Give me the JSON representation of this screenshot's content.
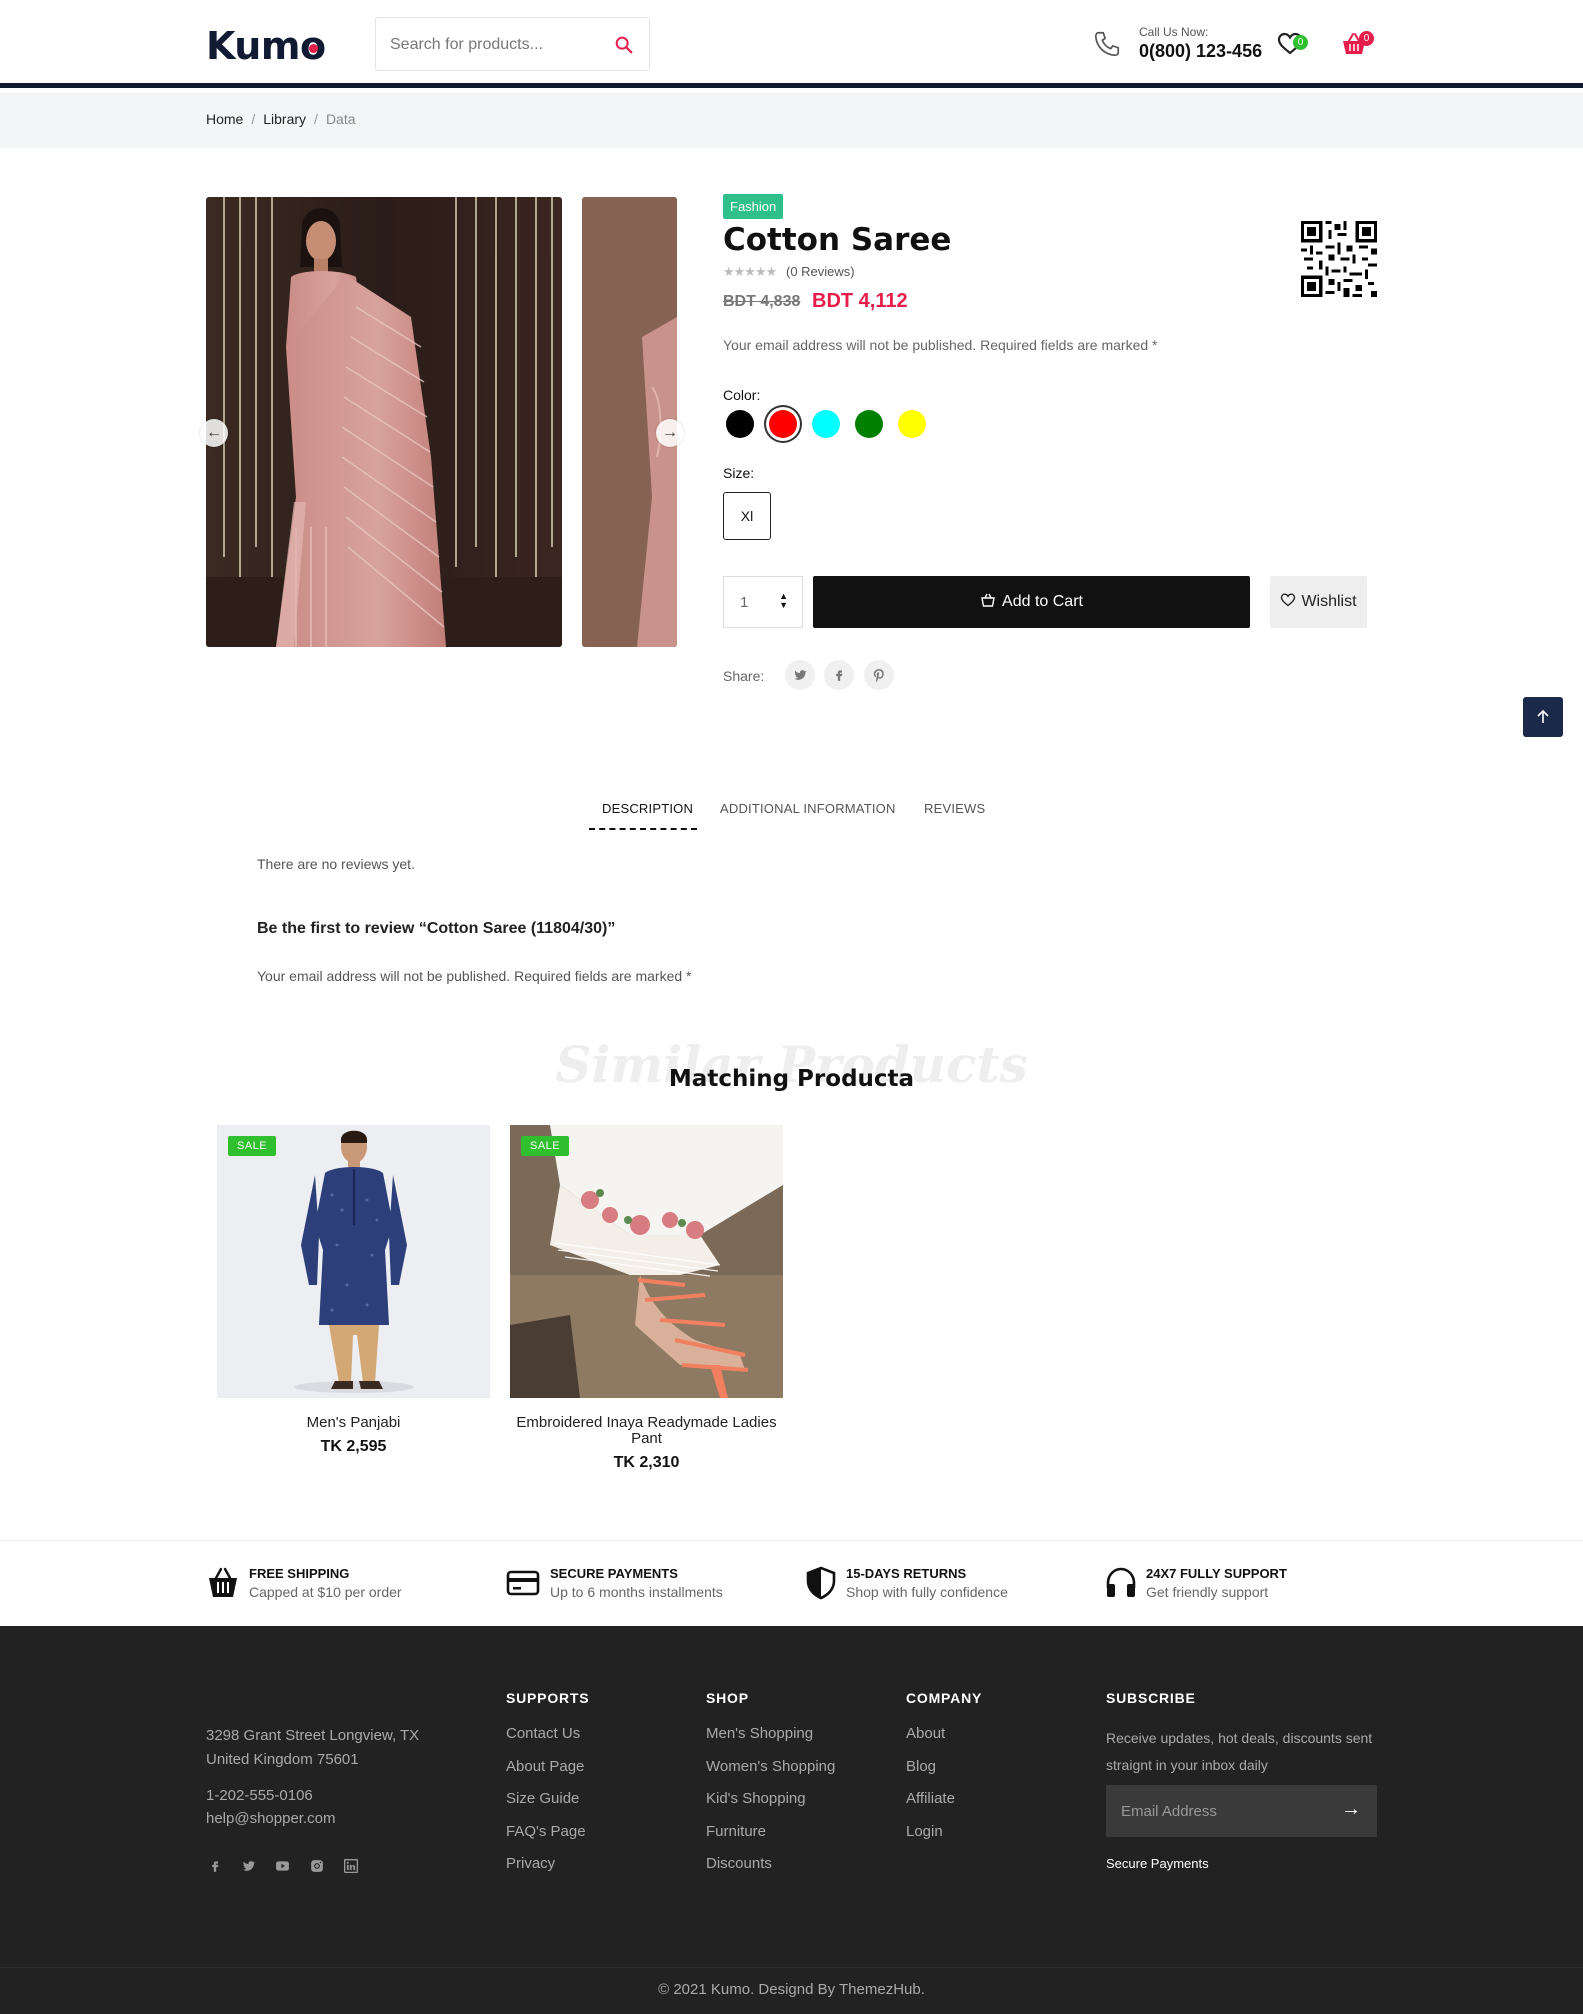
{
  "header": {
    "logo": "Kumo",
    "search_placeholder": "Search for products...",
    "call_label": "Call Us Now:",
    "call_number": "0(800) 123-456",
    "wishlist_count": "0",
    "cart_count": "0"
  },
  "breadcrumb": [
    "Home",
    "Library",
    "Data"
  ],
  "product": {
    "tag": "Fashion",
    "title": "Cotton Saree",
    "stars": "★★★★★",
    "reviews": "(0 Reviews)",
    "old_price": "BDT 4,838",
    "new_price": "BDT 4,112",
    "note": "Your email address will not be published. Required fields are marked *",
    "color_label": "Color:",
    "colors": [
      "#000000",
      "#ff0000",
      "#00ffff",
      "#008000",
      "#ffff00"
    ],
    "selected_color": "#ff0000",
    "size_label": "Size:",
    "size": "Xl",
    "quantity": "1",
    "add_to_cart": "Add to Cart",
    "wishlist": "Wishlist",
    "share_label": "Share:"
  },
  "tabs": [
    "DESCRIPTION",
    "ADDITIONAL INFORMATION",
    "REVIEWS"
  ],
  "reviews_section": {
    "empty": "There are no reviews yet.",
    "prompt": "Be the first to review “Cotton Saree (11804/30)”",
    "note": "Your email address will not be published. Required fields are marked *"
  },
  "matching": {
    "ghost": "Similar Products",
    "title": "Matching Producta",
    "items": [
      {
        "badge": "SALE",
        "name": "Men's Panjabi",
        "price": "TK 2,595"
      },
      {
        "badge": "SALE",
        "name": "Embroidered Inaya Readymade Ladies Pant",
        "price": "TK 2,310"
      }
    ]
  },
  "features": [
    {
      "icon": "basket-icon",
      "title": "FREE SHIPPING",
      "sub": "Capped at $10 per order"
    },
    {
      "icon": "credit-card-icon",
      "title": "SECURE PAYMENTS",
      "sub": "Up to 6 months installments"
    },
    {
      "icon": "shield-icon",
      "title": "15-DAYS RETURNS",
      "sub": "Shop with fully confidence"
    },
    {
      "icon": "headphones-icon",
      "title": "24X7 FULLY SUPPORT",
      "sub": "Get friendly support"
    }
  ],
  "footer": {
    "address": "3298 Grant Street Longview, TX",
    "address2": "United Kingdom 75601",
    "phone": "1-202-555-0106",
    "email": "help@shopper.com",
    "supports_title": "SUPPORTS",
    "supports": [
      "Contact Us",
      "About Page",
      "Size Guide",
      "FAQ's Page",
      "Privacy"
    ],
    "shop_title": "SHOP",
    "shop": [
      "Men's Shopping",
      "Women's Shopping",
      "Kid's Shopping",
      "Furniture",
      "Discounts"
    ],
    "company_title": "COMPANY",
    "company": [
      "About",
      "Blog",
      "Affiliate",
      "Login"
    ],
    "subscribe_title": "SUBSCRIBE",
    "subscribe_text": "Receive updates, hot deals, discounts sent",
    "subscribe_text2": "straignt in your inbox daily",
    "email_placeholder": "Email Address",
    "secure_payments": "Secure Payments",
    "copyright": "© 2021 Kumo. Designd By ThemezHub."
  },
  "colors": {
    "accent": "#e71d4b",
    "tag_green": "#2fbf8a",
    "sale_green": "#2fbf2f",
    "navy": "#101a2e",
    "footer_bg": "#222222"
  }
}
